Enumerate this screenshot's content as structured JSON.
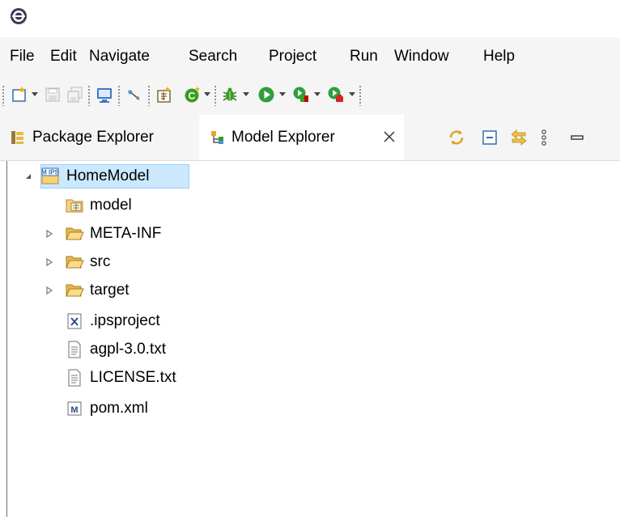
{
  "menu": {
    "file": "File",
    "edit": "Edit",
    "navigate": "Navigate",
    "search": "Search",
    "project": "Project",
    "run": "Run",
    "window": "Window",
    "help": "Help"
  },
  "tabs": {
    "package_explorer": "Package Explorer",
    "model_explorer": "Model Explorer"
  },
  "tree": {
    "root": "HomeModel",
    "items": [
      {
        "label": "model"
      },
      {
        "label": "META-INF"
      },
      {
        "label": "src"
      },
      {
        "label": "target"
      },
      {
        "label": ".ipsproject"
      },
      {
        "label": "agpl-3.0.txt"
      },
      {
        "label": "LICENSE.txt"
      },
      {
        "label": "pom.xml"
      }
    ]
  },
  "icons": {
    "app": "eclipse-icon",
    "root": "ips-project-icon",
    "model": "model-folder-icon",
    "folder": "folder-icon",
    "xml_file": "x-file-icon",
    "text_file": "text-file-icon",
    "maven_file": "maven-file-icon"
  },
  "colors": {
    "selection": "#cce8ff",
    "selection_border": "#99d1ff",
    "folder": "#e8b94a",
    "debug_green": "#3a9d23",
    "run_green": "#2e9e3e",
    "chrome": "#f5f5f5"
  }
}
